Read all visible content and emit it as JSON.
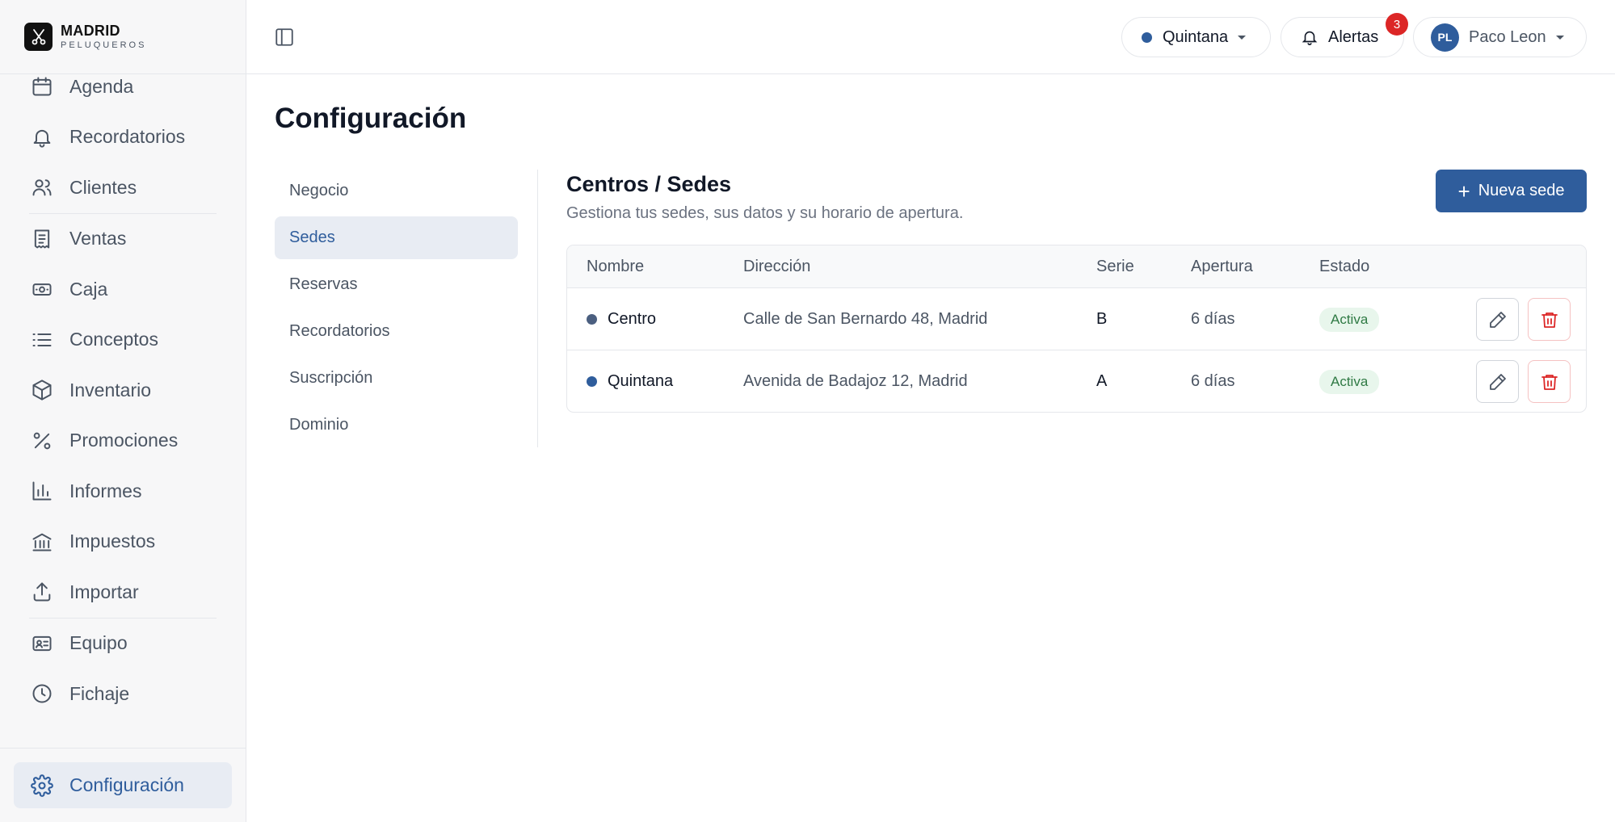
{
  "brand": {
    "name": "MADRID",
    "sub": "PELUQUEROS"
  },
  "sidebar": {
    "items": [
      {
        "label": "Agenda",
        "icon": "calendar-icon"
      },
      {
        "label": "Recordatorios",
        "icon": "bell-icon"
      },
      {
        "label": "Clientes",
        "icon": "users-icon"
      },
      {
        "label": "Ventas",
        "icon": "receipt-icon"
      },
      {
        "label": "Caja",
        "icon": "banknote-icon"
      },
      {
        "label": "Conceptos",
        "icon": "list-icon"
      },
      {
        "label": "Inventario",
        "icon": "box-icon"
      },
      {
        "label": "Promociones",
        "icon": "percent-icon"
      },
      {
        "label": "Informes",
        "icon": "bar-chart-icon"
      },
      {
        "label": "Impuestos",
        "icon": "landmark-icon"
      },
      {
        "label": "Importar",
        "icon": "upload-icon"
      },
      {
        "label": "Equipo",
        "icon": "id-card-icon"
      },
      {
        "label": "Fichaje",
        "icon": "clock-icon"
      }
    ],
    "config": {
      "label": "Configuración",
      "icon": "gear-icon"
    }
  },
  "header": {
    "location": "Quintana",
    "alerts_label": "Alertas",
    "alerts_count": "3",
    "user_initials": "PL",
    "user_name": "Paco Leon"
  },
  "main": {
    "title": "Configuración",
    "subnav": [
      "Negocio",
      "Sedes",
      "Reservas",
      "Recordatorios",
      "Suscripción",
      "Dominio"
    ],
    "active_subnav": "Sedes",
    "section_title": "Centros / Sedes",
    "section_sub": "Gestiona tus sedes, sus datos y su horario de apertura.",
    "new_button": "Nueva sede",
    "table": {
      "headers": [
        "Nombre",
        "Dirección",
        "Serie",
        "Apertura",
        "Estado"
      ],
      "rows": [
        {
          "name": "Centro",
          "dot_color": "#4b5f80",
          "address": "Calle de San Bernardo 48, Madrid",
          "serie": "B",
          "apertura": "6 días",
          "estado": "Activa"
        },
        {
          "name": "Quintana",
          "dot_color": "#2f5d9c",
          "address": "Avenida de Badajoz 12, Madrid",
          "serie": "A",
          "apertura": "6 días",
          "estado": "Activa"
        }
      ]
    }
  },
  "colors": {
    "accent": "#2f5d9c",
    "danger": "#dc2626",
    "success": "#2f7a44"
  }
}
